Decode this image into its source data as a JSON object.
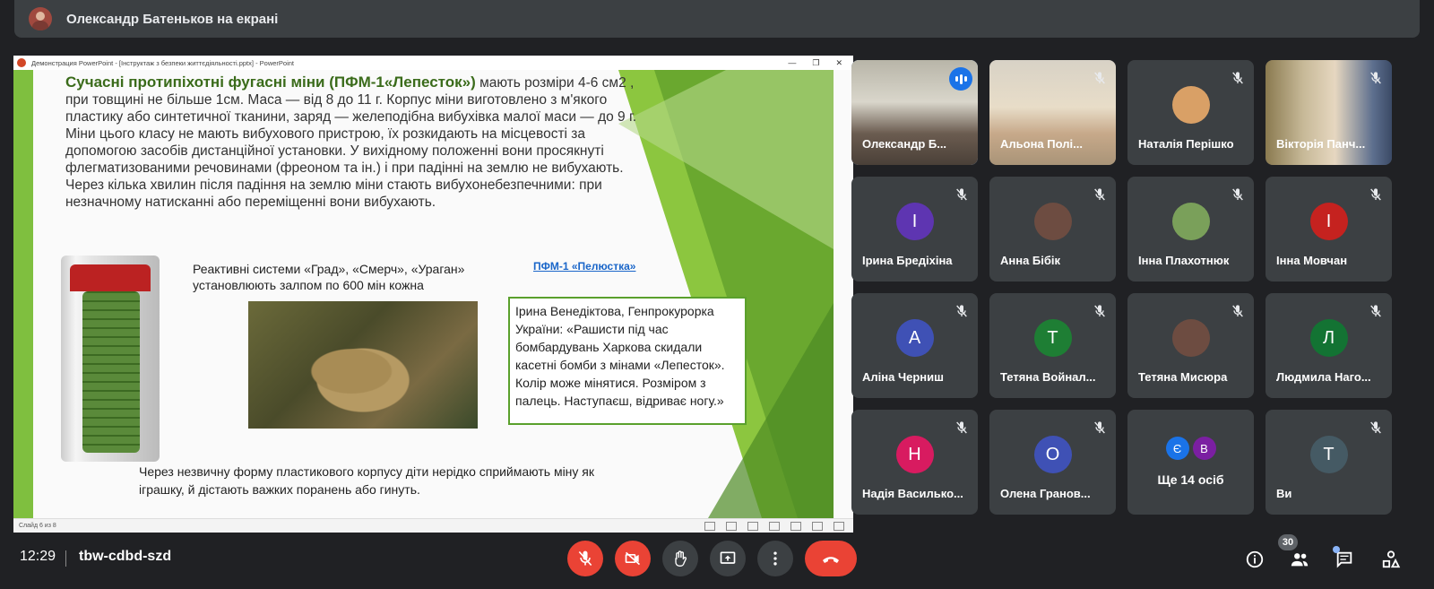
{
  "header": {
    "presenter_title": "Олександр Батеньков на екрані"
  },
  "ppt": {
    "window_title": "Демонстрация PowerPoint - [Інструктаж з безпеки життєдіяльності.pptx] - PowerPoint",
    "status": "Слайд 6 из 8",
    "slide": {
      "heading": "Сучасні протипіхотні фугасні міни (ПФМ-1«Лепесток»)",
      "paragraph": " мають розміри 4-6 см2 , при товщині не більше 1см. Маса — від 8 до 11 г. Корпус міни виготовлено з м'якого пластику або синтетичної тканини, заряд — желеподібна вибухівка малої маси — до 9 г. Міни цього класу не мають вибухового пристрою, їх розкидають на місцевості за допомогою засобів дистанційної установки. У вихідному положенні вони просякнуті флегматизованими речовинами (фреоном та ін.) і при падінні на землю не вибухають. Через кілька хвилин після падіння на землю міни стають вибухонебезпечними: при незначному натисканні або переміщенні вони вибухають.",
      "grad_text": "Реактивні системи «Град», «Смерч», «Ураган» установлюють залпом по 600 мін кожна",
      "link": "ПФМ-1 «Пелюстка»",
      "quote": "Ірина Венедіктова, Генпрокурорка України: «Рашисти під час бомбардувань Харкова скидали касетні бомби з мінами «Лепесток». Колір може мінятися. Розміром з палець. Наступаєш, відриває ногу.»",
      "bottom": "Через незвичну форму пластикового корпусу діти нерідко сприймають міну як іграшку, й дістають важких поранень або гинуть."
    }
  },
  "participants": [
    {
      "name": "Олександр Б...",
      "type": "video",
      "speaking": true
    },
    {
      "name": "Альона Полі...",
      "type": "video"
    },
    {
      "name": "Наталія Перішко",
      "type": "photo"
    },
    {
      "name": "Вікторія Панч...",
      "type": "video"
    },
    {
      "name": "Ірина Бредіхіна",
      "type": "letter",
      "letter": "І",
      "color": "#5e35b1"
    },
    {
      "name": "Анна Бібік",
      "type": "photo"
    },
    {
      "name": "Інна Плахотнюк",
      "type": "photo"
    },
    {
      "name": "Інна Мовчан",
      "type": "letter",
      "letter": "І",
      "color": "#c5221f"
    },
    {
      "name": "Аліна Черниш",
      "type": "letter",
      "letter": "А",
      "color": "#3f51b5"
    },
    {
      "name": "Тетяна Войнал...",
      "type": "letter",
      "letter": "Т",
      "color": "#1e7e34"
    },
    {
      "name": "Тетяна Мисюра",
      "type": "photo"
    },
    {
      "name": "Людмила Наго...",
      "type": "letter",
      "letter": "Л",
      "color": "#137333"
    },
    {
      "name": "Надія Василько...",
      "type": "letter",
      "letter": "Н",
      "color": "#d81b60"
    },
    {
      "name": "Олена Гранов...",
      "type": "letter",
      "letter": "О",
      "color": "#3f51b5"
    },
    {
      "name": "Ще 14 осіб",
      "type": "more",
      "letters": [
        "Є",
        "В"
      ],
      "colors": [
        "#1a73e8",
        "#7b1fa2"
      ]
    },
    {
      "name": "Ви",
      "type": "letter",
      "letter": "Т",
      "color": "#455a64"
    }
  ],
  "bottom": {
    "time": "12:29",
    "meeting_code": "tbw-cdbd-szd",
    "participant_count": "30"
  },
  "colors": {
    "end_call": "#ea4335",
    "accent": "#8ab4f8",
    "slide_green": "#7fbf3f"
  }
}
